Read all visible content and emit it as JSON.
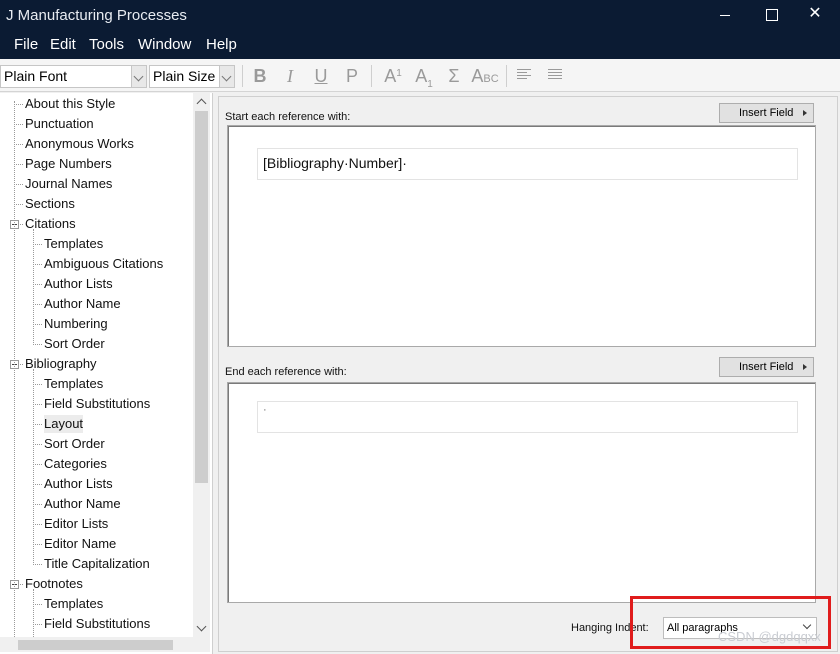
{
  "window": {
    "title": "J Manufacturing Processes",
    "minimize_glyph": "",
    "maximize_glyph": "",
    "close_glyph": "✕"
  },
  "menu": [
    "File",
    "Edit",
    "Tools",
    "Window",
    "Help"
  ],
  "toolbar": {
    "font_value": "Plain Font",
    "size_value": "Plain Size",
    "bold": "B",
    "italic": "I",
    "underline": "U",
    "plain": "P",
    "superscript_base": "A",
    "superscript_mark": "1",
    "subscript_base": "A",
    "subscript_mark": "1",
    "symbol": "Σ",
    "smallcaps": "A",
    "smallcaps_tail": "BC"
  },
  "tree": {
    "items": [
      {
        "label": "About this Style",
        "level": 0
      },
      {
        "label": "Punctuation",
        "level": 0
      },
      {
        "label": "Anonymous Works",
        "level": 0
      },
      {
        "label": "Page Numbers",
        "level": 0
      },
      {
        "label": "Journal Names",
        "level": 0
      },
      {
        "label": "Sections",
        "level": 0
      },
      {
        "label": "Citations",
        "level": 0,
        "expanded": true
      },
      {
        "label": "Templates",
        "level": 1
      },
      {
        "label": "Ambiguous Citations",
        "level": 1
      },
      {
        "label": "Author Lists",
        "level": 1
      },
      {
        "label": "Author Name",
        "level": 1
      },
      {
        "label": "Numbering",
        "level": 1
      },
      {
        "label": "Sort Order",
        "level": 1
      },
      {
        "label": "Bibliography",
        "level": 0,
        "expanded": true
      },
      {
        "label": "Templates",
        "level": 1
      },
      {
        "label": "Field Substitutions",
        "level": 1
      },
      {
        "label": "Layout",
        "level": 1,
        "selected": true
      },
      {
        "label": "Sort Order",
        "level": 1
      },
      {
        "label": "Categories",
        "level": 1
      },
      {
        "label": "Author Lists",
        "level": 1
      },
      {
        "label": "Author Name",
        "level": 1
      },
      {
        "label": "Editor Lists",
        "level": 1
      },
      {
        "label": "Editor Name",
        "level": 1
      },
      {
        "label": "Title Capitalization",
        "level": 1
      },
      {
        "label": "Footnotes",
        "level": 0,
        "expanded": true
      },
      {
        "label": "Templates",
        "level": 1
      },
      {
        "label": "Field Substitutions",
        "level": 1
      }
    ]
  },
  "layout": {
    "start_label": "Start each reference with:",
    "start_value": "[Bibliography·Number]·",
    "end_label": "End each reference with:",
    "end_value": "·",
    "insert_field_label": "Insert Field",
    "hanging_indent_label": "Hanging Indent:",
    "hanging_indent_value": "All paragraphs",
    "highlight_color": "#e01c1c"
  },
  "watermark": "CSDN @dgdqqxx"
}
